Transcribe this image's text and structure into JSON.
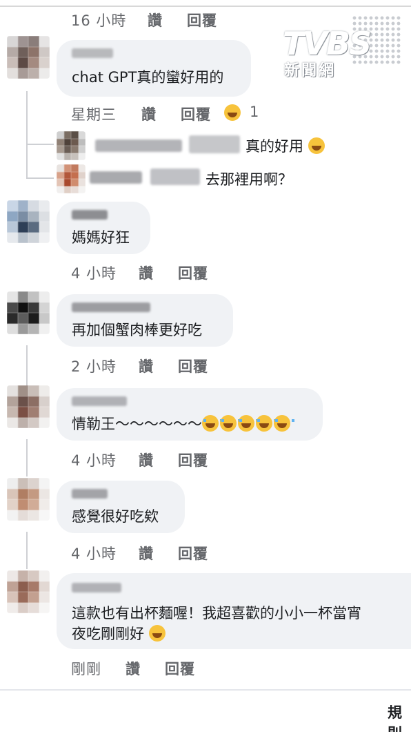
{
  "watermark": {
    "brand": "TVBS",
    "subtitle": "新聞網"
  },
  "labels": {
    "like": "讚",
    "reply": "回覆"
  },
  "comments": [
    {
      "time": "16 小時"
    },
    {
      "text": "chat GPT真的蠻好用的",
      "time": "星期三",
      "reaction_count": "1",
      "replies": [
        {
          "text": "真的好用"
        },
        {
          "text": "去那裡用啊？"
        }
      ]
    },
    {
      "text": "媽媽好狂",
      "time": "4 小時"
    },
    {
      "text": "再加個蟹肉棒更好吃",
      "time": "2 小時"
    },
    {
      "text": "情勒王～～～～～～",
      "time": "4 小時"
    },
    {
      "text": "感覺很好吃欸",
      "time": "4 小時"
    },
    {
      "text_line1": "這款也有出杯麵喔！我超喜歡的小小一杯當宵",
      "text_line2": "夜吃剛剛好",
      "time": "剛剛"
    }
  ],
  "footer": {
    "text": "規則"
  }
}
